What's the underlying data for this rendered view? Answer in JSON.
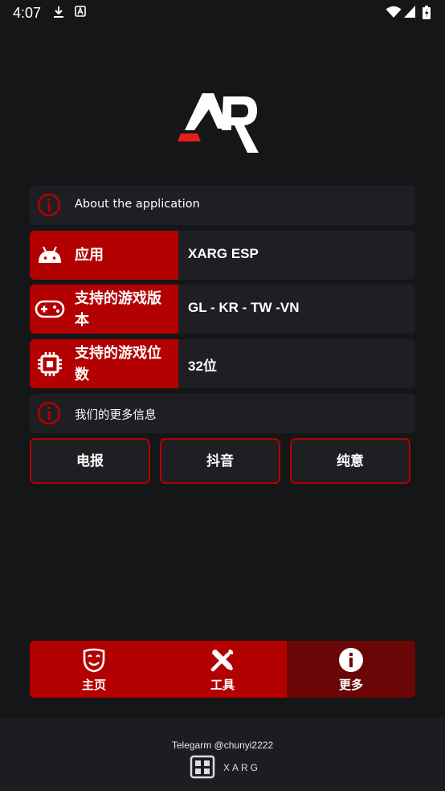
{
  "status_bar": {
    "time": "4:07",
    "left_icons": [
      "download-icon",
      "a-box-icon"
    ],
    "right_icons": [
      "wifi-icon",
      "signal-icon",
      "battery-icon"
    ]
  },
  "logo": {
    "text": "AR",
    "brand_colors": {
      "red": "#e11d1d",
      "white": "#ffffff"
    }
  },
  "about": {
    "label": "About the application",
    "icon": "info-circle-icon"
  },
  "details": [
    {
      "icon": "android-icon",
      "label": "应用",
      "value": "XARG ESP"
    },
    {
      "icon": "gamepad-icon",
      "label": "支持的游戏版本",
      "value": "GL - KR - TW -VN"
    },
    {
      "icon": "chip-icon",
      "label": "支持的游戏位数",
      "value": "32位"
    }
  ],
  "more_info": {
    "label": "我们的更多信息",
    "icon": "info-circle-icon"
  },
  "links": [
    {
      "label": "电报"
    },
    {
      "label": "抖音"
    },
    {
      "label": "纯意"
    }
  ],
  "bottom_nav": [
    {
      "label": "主页",
      "icon": "theater-mask-icon",
      "active": false
    },
    {
      "label": "工具",
      "icon": "tools-icon",
      "active": false
    },
    {
      "label": "更多",
      "icon": "info-filled-icon",
      "active": true
    }
  ],
  "footer": {
    "telegram": "Telegarm @chunyi2222",
    "brand": "XARG"
  },
  "colors": {
    "accent": "#b30000",
    "accent_dark": "#6b0606",
    "background": "#151618",
    "card": "#1e1f23"
  }
}
